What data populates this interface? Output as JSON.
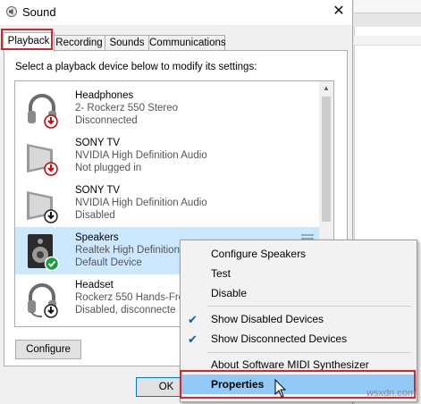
{
  "window": {
    "title": "Sound",
    "close_glyph": "✕"
  },
  "tabs": [
    {
      "label": "Playback",
      "active": true
    },
    {
      "label": "Recording",
      "active": false
    },
    {
      "label": "Sounds",
      "active": false
    },
    {
      "label": "Communications",
      "active": false
    }
  ],
  "instructions": "Select a playback device below to modify its settings:",
  "devices": [
    {
      "name": "Headphones",
      "line1": "2- Rockerz 550 Stereo",
      "line2": "Disconnected",
      "icon": "headphones-icon",
      "badge": "red-down-arrow-badge",
      "selected": false
    },
    {
      "name": "SONY TV",
      "line1": "NVIDIA High Definition Audio",
      "line2": "Not plugged in",
      "icon": "monitor-icon",
      "badge": "red-down-arrow-badge",
      "selected": false
    },
    {
      "name": "SONY TV",
      "line1": "NVIDIA High Definition Audio",
      "line2": "Disabled",
      "icon": "monitor-icon",
      "badge": "black-down-arrow-badge",
      "selected": false
    },
    {
      "name": "Speakers",
      "line1": "Realtek High Definition",
      "line2": "Default Device",
      "icon": "speaker-icon",
      "badge": "green-check-badge",
      "selected": true
    },
    {
      "name": "Headset",
      "line1": "Rockerz 550 Hands-Fre",
      "line2": "Disabled, disconnecte",
      "icon": "headset-icon",
      "badge": "black-down-arrow-badge",
      "selected": false
    }
  ],
  "buttons": {
    "configure": "Configure",
    "ok": "OK"
  },
  "context_menu": {
    "items": [
      {
        "label": "Configure Speakers",
        "checked": false
      },
      {
        "label": "Test",
        "checked": false
      },
      {
        "label": "Disable",
        "checked": false
      },
      {
        "label": "Show Disabled Devices",
        "checked": true
      },
      {
        "label": "Show Disconnected Devices",
        "checked": true
      },
      {
        "label": "About Software MIDI Synthesizer",
        "checked": false
      },
      {
        "label": "Properties",
        "checked": false,
        "bold": true,
        "hovered": true
      }
    ]
  },
  "watermark": "wsxdn.com",
  "colors": {
    "selection": "#cce8ff",
    "menu_hover": "#91c9f7",
    "highlight_box": "#d4262c",
    "check": "#0063b1"
  }
}
